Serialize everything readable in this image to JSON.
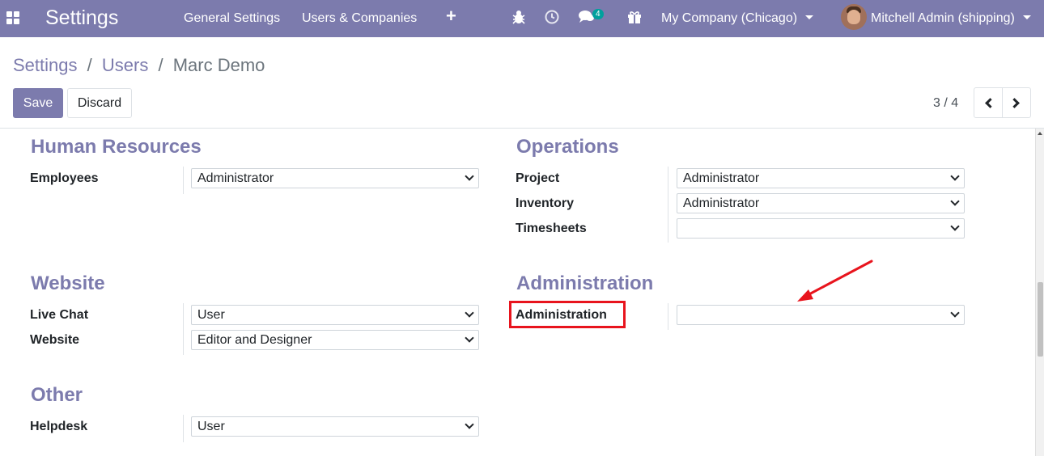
{
  "navbar": {
    "app_title": "Settings",
    "menu": [
      "General Settings",
      "Users & Companies"
    ],
    "plus_label": "+",
    "messages_badge": "4",
    "company": "My Company (Chicago)",
    "user": "Mitchell Admin (shipping)"
  },
  "breadcrumb": {
    "items": [
      "Settings",
      "Users",
      "Marc Demo"
    ],
    "separator": "/"
  },
  "buttons": {
    "save": "Save",
    "discard": "Discard"
  },
  "pager": {
    "value": "3 / 4"
  },
  "groups": {
    "human_resources": {
      "title": "Human Resources",
      "fields": [
        {
          "label": "Employees",
          "value": "Administrator"
        }
      ]
    },
    "operations": {
      "title": "Operations",
      "fields": [
        {
          "label": "Project",
          "value": "Administrator"
        },
        {
          "label": "Inventory",
          "value": "Administrator"
        },
        {
          "label": "Timesheets",
          "value": ""
        }
      ]
    },
    "website": {
      "title": "Website",
      "fields": [
        {
          "label": "Live Chat",
          "value": "User"
        },
        {
          "label": "Website",
          "value": "Editor and Designer"
        }
      ]
    },
    "administration": {
      "title": "Administration",
      "fields": [
        {
          "label": "Administration",
          "value": ""
        }
      ]
    },
    "other": {
      "title": "Other",
      "fields": [
        {
          "label": "Helpdesk",
          "value": "User"
        }
      ]
    }
  },
  "colors": {
    "brand": "#7c7bad",
    "annotation": "#e8141d",
    "badge": "#00a09d"
  },
  "icons": [
    "apps-icon",
    "bug-icon",
    "clock-icon",
    "chat-icon",
    "gift-icon",
    "avatar"
  ]
}
